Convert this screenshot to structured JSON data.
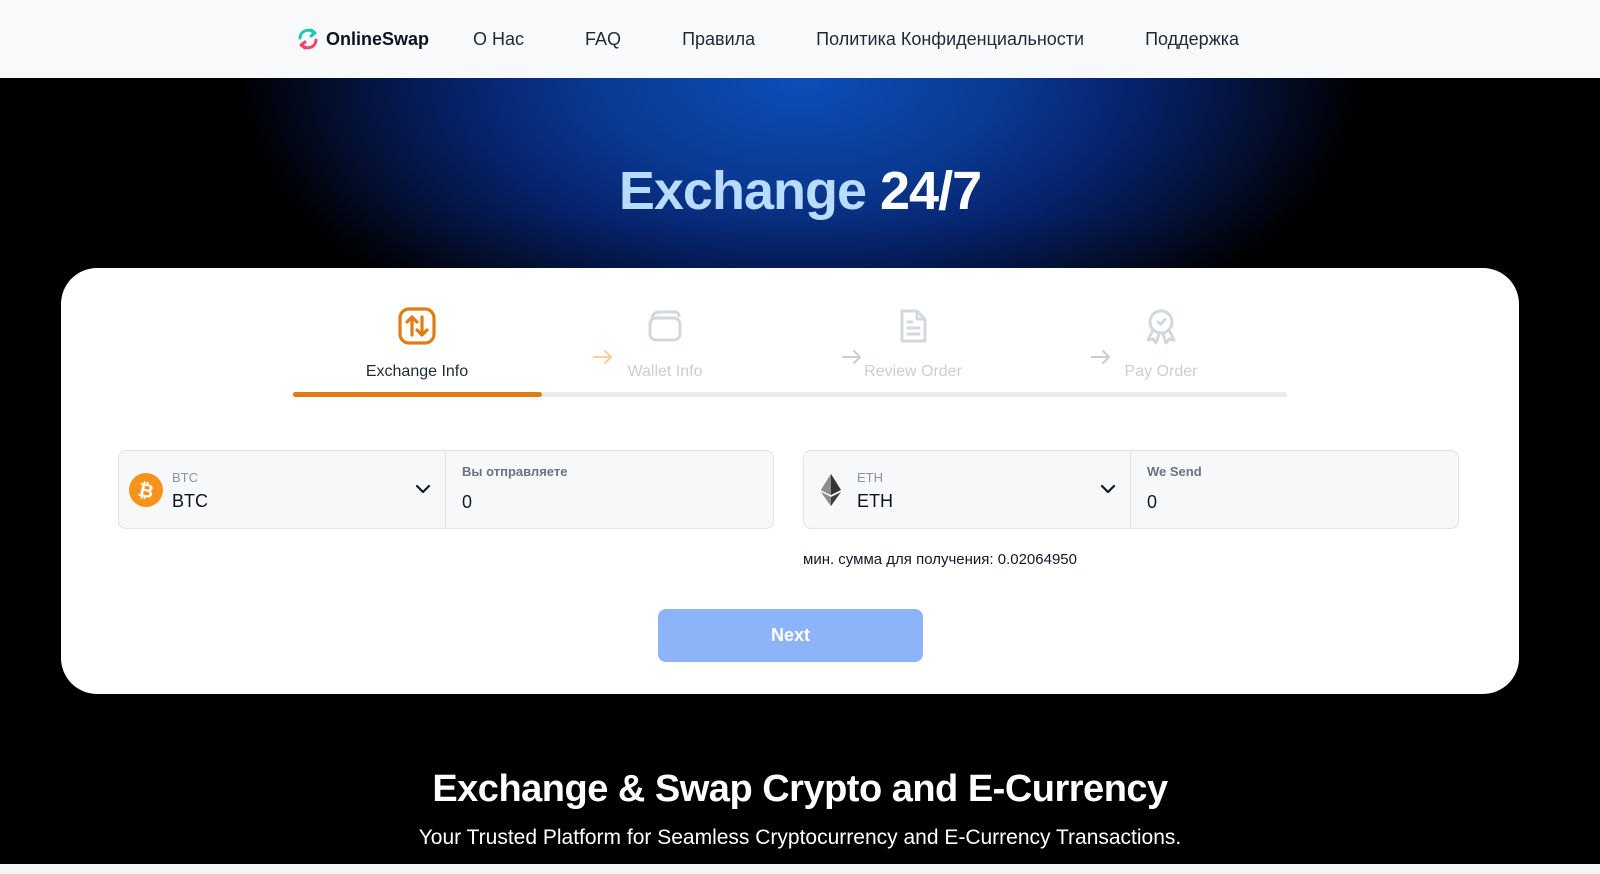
{
  "header": {
    "brand": "OnlineSwap",
    "nav": [
      {
        "label": "О Нас"
      },
      {
        "label": "FAQ"
      },
      {
        "label": "Правила"
      },
      {
        "label": "Политика Конфиденциальности"
      },
      {
        "label": "Поддержка"
      }
    ]
  },
  "hero": {
    "title_part1": "Exchange",
    "title_part2": "24/7"
  },
  "steps": [
    {
      "label": "Exchange Info",
      "icon": "exchange-arrows-icon",
      "active": true
    },
    {
      "label": "Wallet Info",
      "icon": "wallet-icon",
      "active": false
    },
    {
      "label": "Review Order",
      "icon": "document-icon",
      "active": false
    },
    {
      "label": "Pay Order",
      "icon": "award-badge-icon",
      "active": false
    }
  ],
  "progress": {
    "completed_steps": 1,
    "total_steps": 4
  },
  "send": {
    "coin_small": "BTC",
    "coin_big": "BTC",
    "amount_label": "Вы отправляете",
    "amount_value": "0",
    "icon": "bitcoin-icon"
  },
  "receive": {
    "coin_small": "ETH",
    "coin_big": "ETH",
    "amount_label": "We Send",
    "amount_value": "0",
    "icon": "ethereum-icon"
  },
  "min_note": "мин. сумма для получения: 0.02064950",
  "next_label": "Next",
  "section": {
    "title": "Exchange & Swap Crypto and E-Currency",
    "subtitle": "Your Trusted Platform for Seamless Cryptocurrency and E-Currency Transactions."
  },
  "colors": {
    "accent": "#e07c12",
    "next_button": "#8db4f8",
    "hero_blue": "#0a4fb8",
    "title_light": "#b7dcff",
    "bitcoin": "#f7931a"
  }
}
